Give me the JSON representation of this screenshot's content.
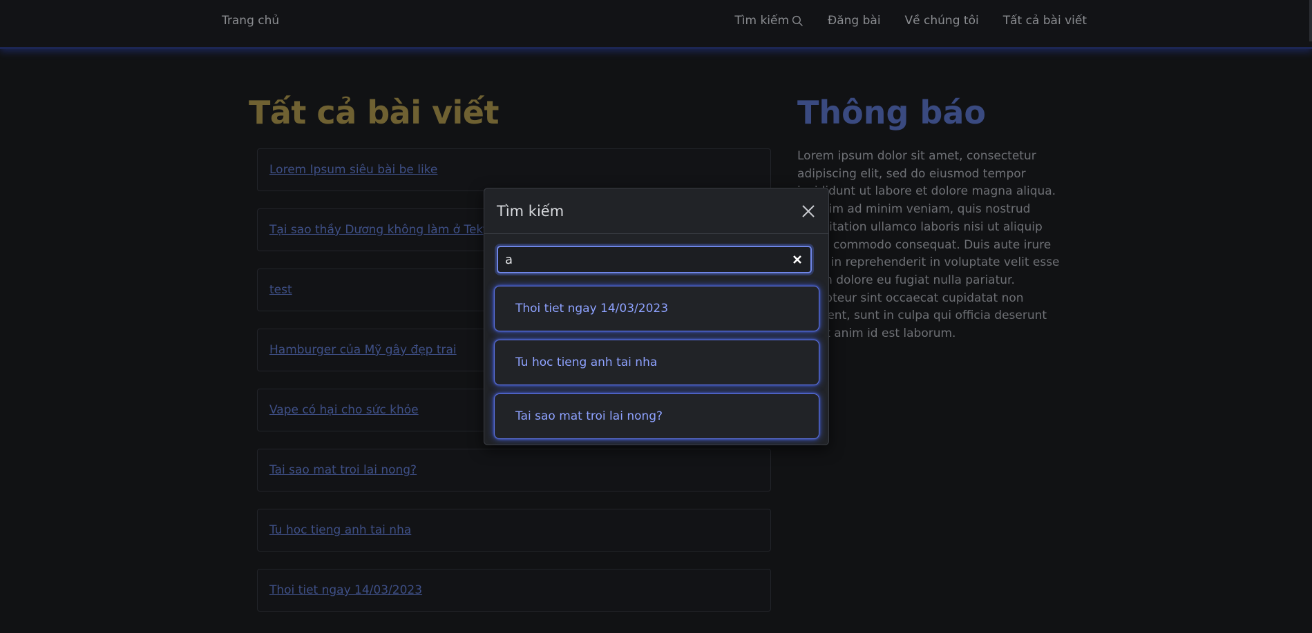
{
  "navbar": {
    "brand": "Trang chủ",
    "links": [
      "Tìm kiếm",
      "Đăng bài",
      "Về chúng tôi",
      "Tất cả bài viết"
    ]
  },
  "main": {
    "title": "Tất cả bài viết",
    "posts": [
      "Lorem Ipsum siêu bài be like",
      "Tại sao thầy Dương không làm ở Teky nữa",
      "test",
      "Hamburger của Mỹ gây đẹp trai",
      "Vape có hại cho sức khỏe",
      "Tai sao mat troi lai nong?",
      "Tu hoc tieng anh tai nha",
      "Thoi tiet ngay 14/03/2023"
    ]
  },
  "sidebar": {
    "title": "Thông báo",
    "text": "Lorem ipsum dolor sit amet, consectetur adipiscing elit, sed do eiusmod tempor incididunt ut labore et dolore magna aliqua. Ut enim ad minim veniam, quis nostrud exercitation ullamco laboris nisi ut aliquip ex ea commodo consequat. Duis aute irure dolor in reprehenderit in voluptate velit esse cillum dolore eu fugiat nulla pariatur. Excepteur sint occaecat cupidatat non proident, sunt in culpa qui officia deserunt mollit anim id est laborum."
  },
  "modal": {
    "title": "Tìm kiếm",
    "search_value": "a",
    "results": [
      "Thoi tiet ngay 14/03/2023",
      "Tu hoc tieng anh tai nha",
      "Tai sao mat troi lai nong?"
    ]
  },
  "colors": {
    "background": "#111214",
    "main_title": "#6f6132",
    "sidebar_title": "#3a4a80",
    "link": "#3e4f86",
    "accent": "#5d72e0"
  }
}
